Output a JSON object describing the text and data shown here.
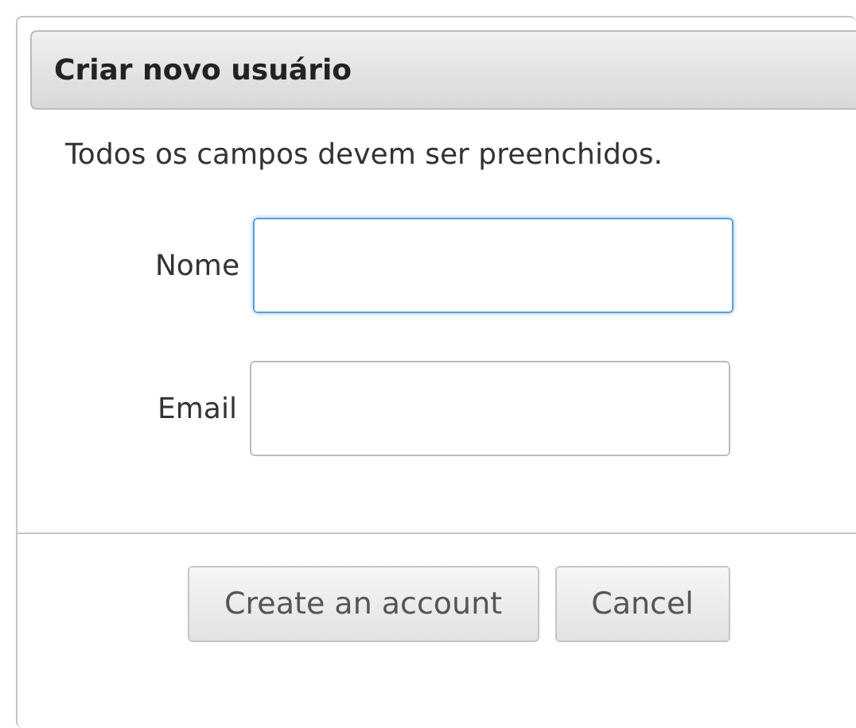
{
  "dialog": {
    "title": "Criar novo usuário",
    "message": "Todos os campos devem ser preenchidos.",
    "fields": [
      {
        "label": "Nome",
        "focused": true
      },
      {
        "label": "Email",
        "focused": false
      }
    ],
    "buttons": [
      "Create an account",
      "Cancel"
    ]
  }
}
